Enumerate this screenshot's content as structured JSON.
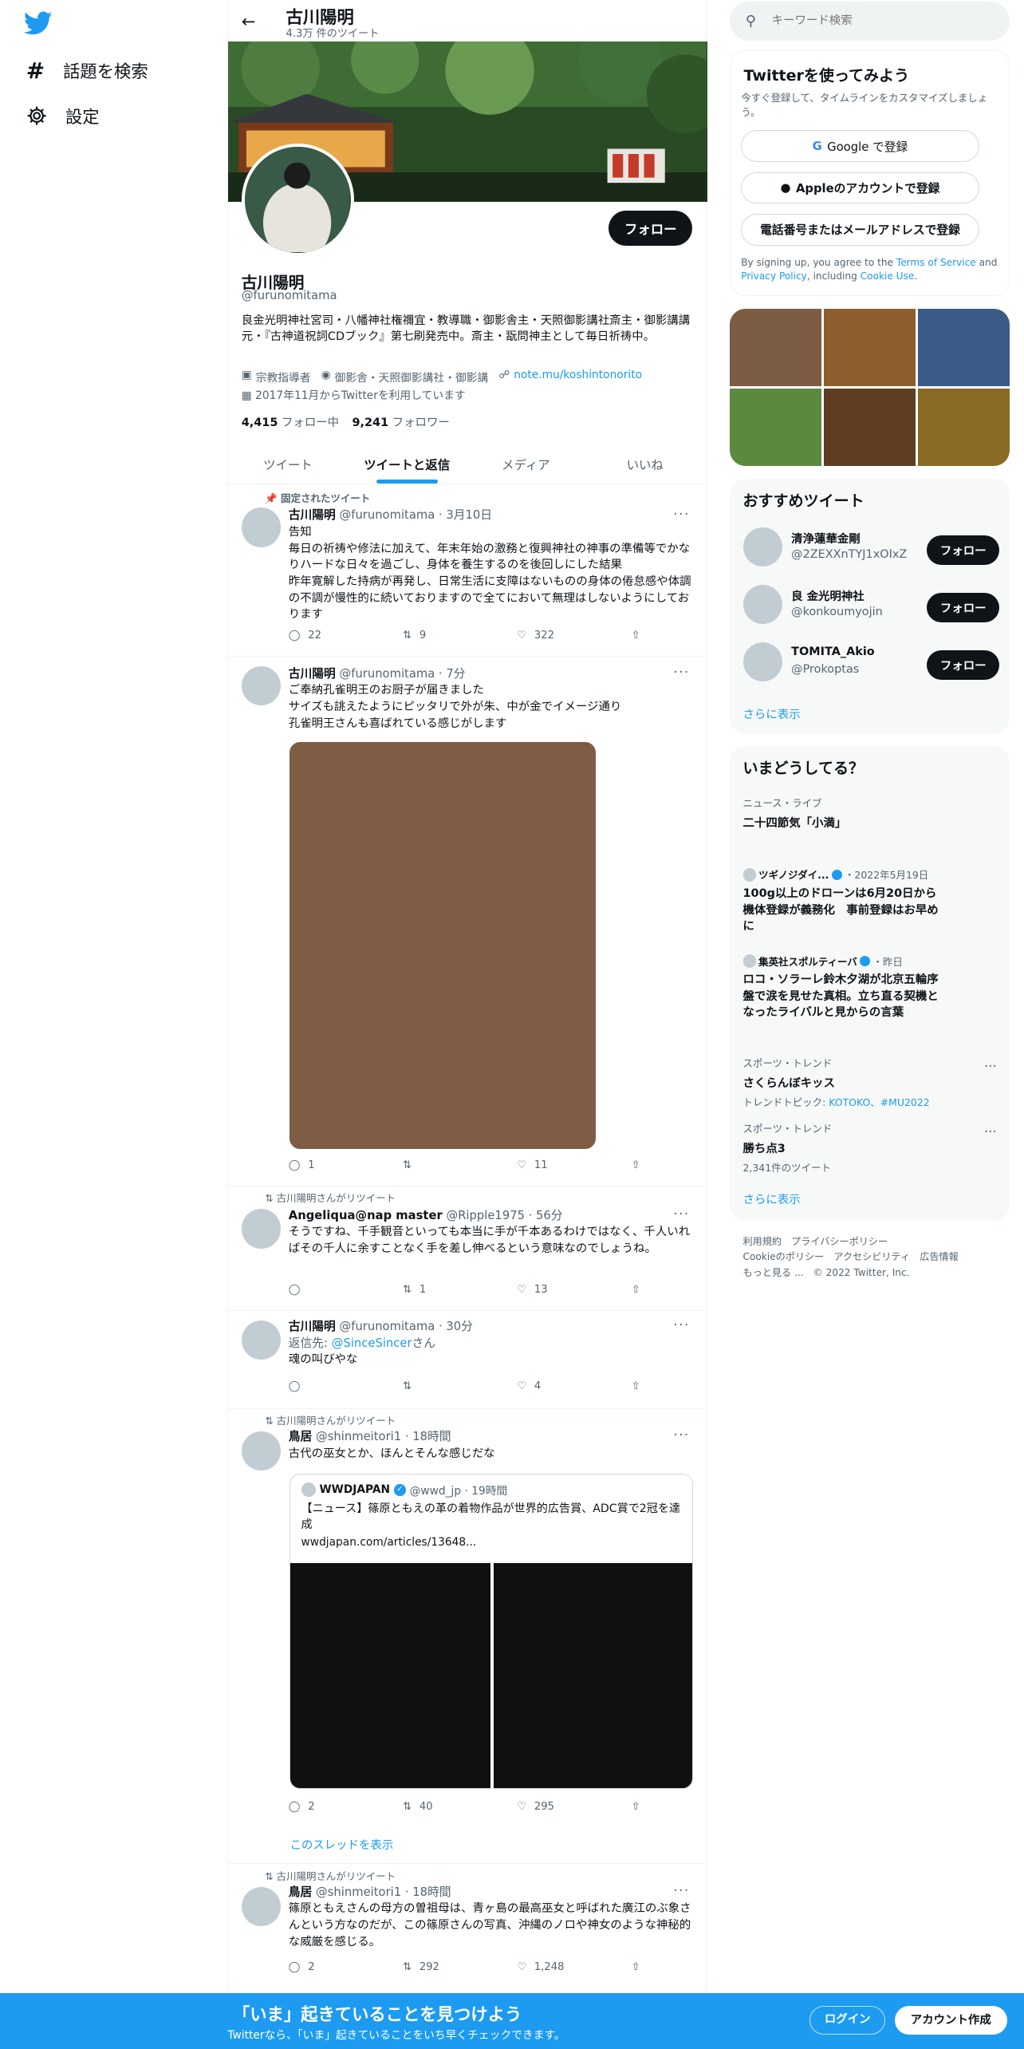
{
  "nav": {
    "explore": "話題を検索",
    "settings": "設定"
  },
  "header": {
    "name": "古川陽明",
    "count": "4.3万 件のツイート"
  },
  "profile": {
    "follow": "フォロー",
    "name": "古川陽明",
    "handle": "@furunomitama",
    "bio": "良金光明神社宮司・八幡神社権禰宜・教導職・御影舎主・天照御影講社斎主・御影講講元・『古神道祝詞CDブック』第七刷発売中。斎主・翫問神主として毎日祈祷中。",
    "category": "宗教指導者",
    "location": "御影舎・天照御影講社・御影講",
    "link": "note.mu/koshintonorito",
    "joined": "2017年11月からTwitterを利用しています",
    "following_n": "4,415",
    "following_l": "フォロー中",
    "followers_n": "9,241",
    "followers_l": "フォロワー"
  },
  "tabs": [
    "ツイート",
    "ツイートと返信",
    "メディア",
    "いいね"
  ],
  "tweets": [
    {
      "ctx": "固定されたツイート",
      "name": "古川陽明",
      "meta": "@furunomitama · 3月10日",
      "text": "告知\n毎日の祈祷や修法に加えて、年末年始の激務と復興神社の神事の準備等でかなりハードな日々を過ごし、身体を養生するのを後回しにした結果\n昨年寛解した持病が再発し、日常生活に支障はないものの身体の倦怠感や体調の不調が慢性的に続いておりますので全てにおいて無理はしないようにしております",
      "reply": "22",
      "rt": "9",
      "like": "322"
    },
    {
      "name": "古川陽明",
      "meta": "@furunomitama · 7分",
      "text": "ご奉納孔雀明王のお厨子が届きました\nサイズも誂えたようにピッタリで外が朱、中が金でイメージ通り\n孔雀明王さんも喜ばれている感じがします",
      "reply": "1",
      "rt": "",
      "like": "11"
    },
    {
      "ctx": "古川陽明さんがリツイート",
      "name": "Angeliqua@nap master",
      "meta": "@Ripple1975 · 56分",
      "text": "そうですね、千手観音といっても本当に手が千本あるわけではなく、千人いればその千人に余すことなく手を差し伸べるという意味なのでしょうね。",
      "reply": "",
      "rt": "1",
      "like": "13"
    },
    {
      "name": "古川陽明",
      "meta": "@furunomitama · 30分",
      "reply_to": "返信先: ",
      "reply_user": "@SinceSincer",
      "reply_suffix": "さん",
      "text": "魂の叫びやな",
      "reply": "",
      "rt": "",
      "like": "4"
    },
    {
      "ctx": "古川陽明さんがリツイート",
      "name": "鳥居",
      "meta": "@shinmeitori1 · 18時間",
      "text": "古代の巫女とか、ほんとそんな感じだな",
      "quote_name": "WWDJAPAN",
      "quote_meta": "@wwd_jp · 19時間",
      "quote_text": "【ニュース】篠原ともえの革の着物作品が世界的広告賞、ADC賞で2冠を達成",
      "quote_url": "wwdjapan.com/articles/13648...",
      "reply": "2",
      "rt": "40",
      "like": "295",
      "thread": "このスレッドを表示"
    },
    {
      "ctx": "古川陽明さんがリツイート",
      "name": "鳥居",
      "meta": "@shinmeitori1 · 18時間",
      "text": "篠原ともえさんの母方の曽祖母は、青ヶ島の最高巫女と呼ばれた廣江のぶ象さんという方なのだが、この篠原さんの写真、沖縄のノロや神女のような神秘的な威厳を感じる。",
      "reply": "2",
      "rt": "292",
      "like": "1,248"
    }
  ],
  "search": {
    "placeholder": "キーワード検索"
  },
  "signup": {
    "title": "Twitterを使ってみよう",
    "sub": "今すぐ登録して、タイムラインをカスタマイズしましょう。",
    "google": "Google で登録",
    "apple": "Appleのアカウントで登録",
    "phone": "電話番号またはメールアドレスで登録",
    "legal1": "By signing up, you agree to the ",
    "terms": "Terms of Service",
    "legal2": " and ",
    "privacy": "Privacy Policy",
    "legal3": ", including ",
    "cookie": "Cookie Use",
    "legal4": "."
  },
  "grid_colors": [
    "#7d5c44",
    "#8e5f2e",
    "#3b5a86",
    "#5a8a3e",
    "#5e3d22",
    "#8a6a24"
  ],
  "whotofollow": {
    "title": "おすすめツイート",
    "users": [
      {
        "name": "清浄蓮華金剛",
        "handle": "@2ZEXXnTYJ1xOIxZ"
      },
      {
        "name": "良 金光明神社",
        "handle": "@konkoumyojin"
      },
      {
        "name": "TOMITA_Akio",
        "handle": "@Prokoptas"
      }
    ],
    "follow": "フォロー",
    "more": "さらに表示"
  },
  "trends": {
    "title": "いまどうしてる？",
    "items": [
      {
        "meta": "ニュース・ライブ",
        "title": "二十四節気「小満」"
      },
      {
        "source": "ツギノジダイ...",
        "date": "・2022年5月19日",
        "title": "100g以上のドローンは6月20日から機体登録が義務化　事前登録はお早めに"
      },
      {
        "source": "集英社スポルティーバ",
        "date": "・昨日",
        "title": "ロコ・ソラーレ鈴木夕湖が北京五輪序盤で涙を見せた真相。立ち直る契機となったライバルと見からの言葉"
      },
      {
        "meta": "スポーツ・トレンド",
        "title": "さくらんぼキッス",
        "sub": "トレンドトピック: ",
        "tags": "KOTOKO、#MU2022"
      },
      {
        "meta": "スポーツ・トレンド",
        "title": "勝ち点3",
        "sub": "2,341件のツイート"
      }
    ],
    "more": "さらに表示"
  },
  "footer": {
    "l1": "利用規約　プライバシーポリシー",
    "l2": "Cookieのポリシー　アクセシビリティ　広告情報",
    "l3": "もっと見る ...　© 2022 Twitter, Inc."
  },
  "banner": {
    "title": "「いま」起きていることを見つけよう",
    "sub": "Twitterなら、「いま」起きていることをいち早くチェックできます。",
    "login": "ログイン",
    "signup": "アカウント作成"
  }
}
